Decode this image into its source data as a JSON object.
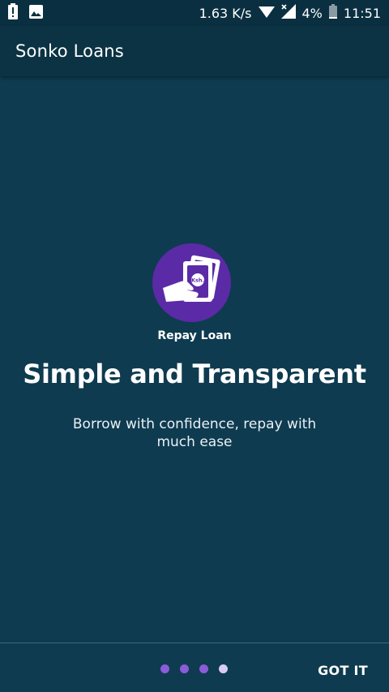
{
  "status_bar": {
    "network_speed": "1.63 K/s",
    "battery_percent": "4%",
    "time": "11:51"
  },
  "app_bar": {
    "title": "Sonko Loans"
  },
  "slide": {
    "logo_text": "Ksh.",
    "logo_label": "Repay Loan",
    "headline": "Simple and Transparent",
    "description": "Borrow with confidence, repay with much ease"
  },
  "pager": {
    "total_pages": 4,
    "current_page": 4
  },
  "actions": {
    "got_it_label": "GOT IT"
  },
  "colors": {
    "background": "#0e3b50",
    "app_bar": "#0b3344",
    "accent_purple": "#5b2aa6",
    "dot_inactive": "#8b5cd8",
    "dot_active": "#d9ccf4"
  }
}
